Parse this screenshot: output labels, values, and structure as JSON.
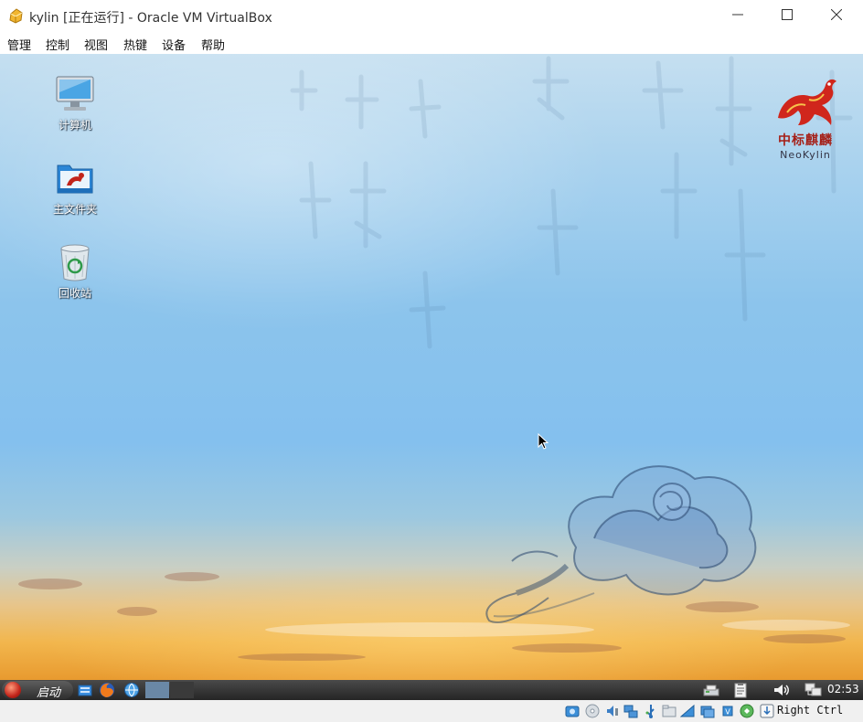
{
  "window": {
    "title": "kylin [正在运行] - Oracle VM VirtualBox",
    "icon": "virtualbox-app-icon",
    "controls": [
      "minimize-icon",
      "maximize-icon",
      "close-icon"
    ]
  },
  "menubar": {
    "items": [
      "管理",
      "控制",
      "视图",
      "热键",
      "设备",
      "帮助"
    ]
  },
  "desktop": {
    "icons": [
      {
        "label": "计算机",
        "icon": "computer-monitor-icon"
      },
      {
        "label": "主文件夹",
        "icon": "home-folder-icon"
      },
      {
        "label": "回收站",
        "icon": "recycle-bin-icon"
      }
    ],
    "brand": {
      "name_cn": "中标麒麟",
      "name_en": "NeoKylin",
      "icon": "kylin-logo-icon"
    }
  },
  "taskbar": {
    "start_label": "启动",
    "launchers": [
      "file-manager-icon",
      "firefox-icon",
      "network-browser-icon"
    ],
    "tray": [
      "network-printer-icon",
      "clipboard-icon",
      "volume-icon",
      "network-icon"
    ],
    "clock": "02:53"
  },
  "statusbar": {
    "indicators": [
      "hard-disk-icon",
      "optical-drive-icon",
      "audio-icon",
      "network-adapter-icon",
      "usb-icon",
      "shared-folders-icon",
      "display-icon",
      "video-capture-icon",
      "cpu-icon",
      "mouse-integration-icon",
      "host-key-icon"
    ],
    "host_key": "Right Ctrl"
  },
  "colors": {
    "taskbar": "#2f2f2f",
    "sky_top": "#c5dff0",
    "sky_mid": "#84c0ee",
    "sunset": "#e89a2f",
    "brand_red": "#a52018"
  }
}
